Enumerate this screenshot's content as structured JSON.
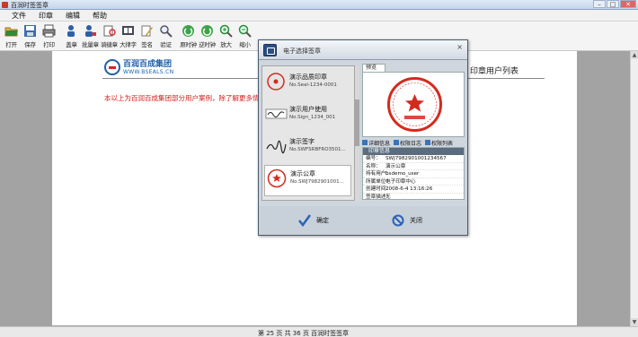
{
  "window": {
    "title": "百润时签签章",
    "minimize": "–",
    "maximize": "□",
    "close": "✕"
  },
  "menu": [
    "文件",
    "印章",
    "编辑",
    "帮助"
  ],
  "toolbar": [
    {
      "label": "打开",
      "icon": "open-folder-icon"
    },
    {
      "label": "保存",
      "icon": "save-icon"
    },
    {
      "label": "打印",
      "icon": "print-icon"
    },
    {
      "label": "盖章",
      "icon": "user-stamp-icon"
    },
    {
      "label": "批量章",
      "icon": "batch-stamp-icon"
    },
    {
      "label": "骑缝章",
      "icon": "seam-stamp-icon"
    },
    {
      "label": "大律字",
      "icon": "pages-icon"
    },
    {
      "label": "签名",
      "icon": "pen-sign-icon"
    },
    {
      "label": "验证",
      "icon": "verify-magnifier-icon"
    },
    {
      "label": "原时钟",
      "icon": "clock-rotate-icon"
    },
    {
      "label": "逆时钟",
      "icon": "clock-reverse-icon"
    },
    {
      "label": "放大",
      "icon": "zoom-in-icon"
    },
    {
      "label": "缩小",
      "icon": "zoom-out-icon"
    }
  ],
  "document": {
    "logo_cn": "百润百成集团",
    "logo_en": "WWW.BSEALS.CN",
    "notice": "本以上为百润百成集团部分用户案例，除了解更多情况",
    "right_title": "印章用户列表"
  },
  "statusbar": "第 25 页 共 36 页   百润时签签章",
  "dialog": {
    "title": "电子选择签章",
    "close": "×",
    "seals": [
      {
        "name": "演示品质印章",
        "sn": "No.Seal-1234-0001"
      },
      {
        "name": "演示用户使用",
        "sn": "No.Sign_1234_001"
      },
      {
        "name": "演示签字",
        "sn": "No.SWFSRBFRO3501..."
      },
      {
        "name": "演示公章",
        "sn": "No.SWJ7982901001..."
      }
    ],
    "preview_tab": "预览",
    "actions": [
      "详细信息",
      "权限日志",
      "权限列表"
    ],
    "info_header": "印章信息",
    "info_rows": [
      {
        "k": "编号：",
        "v": "SWJ7982901001234567"
      },
      {
        "k": "名称：",
        "v": "演示公章"
      },
      {
        "k": "持有用户：",
        "v": "bsdemo_user"
      },
      {
        "k": "所属单位：",
        "v": "电子印章中心"
      },
      {
        "k": "创建时间：",
        "v": "2008-6-4 13:16:26"
      },
      {
        "k": "签章描述：",
        "v": "无"
      }
    ],
    "ok_label": "确定",
    "cancel_label": "关闭"
  },
  "colors": {
    "stamp_red": "#d42a1e",
    "accent_blue": "#1f5fa8",
    "notice_red": "#d41a1a"
  }
}
